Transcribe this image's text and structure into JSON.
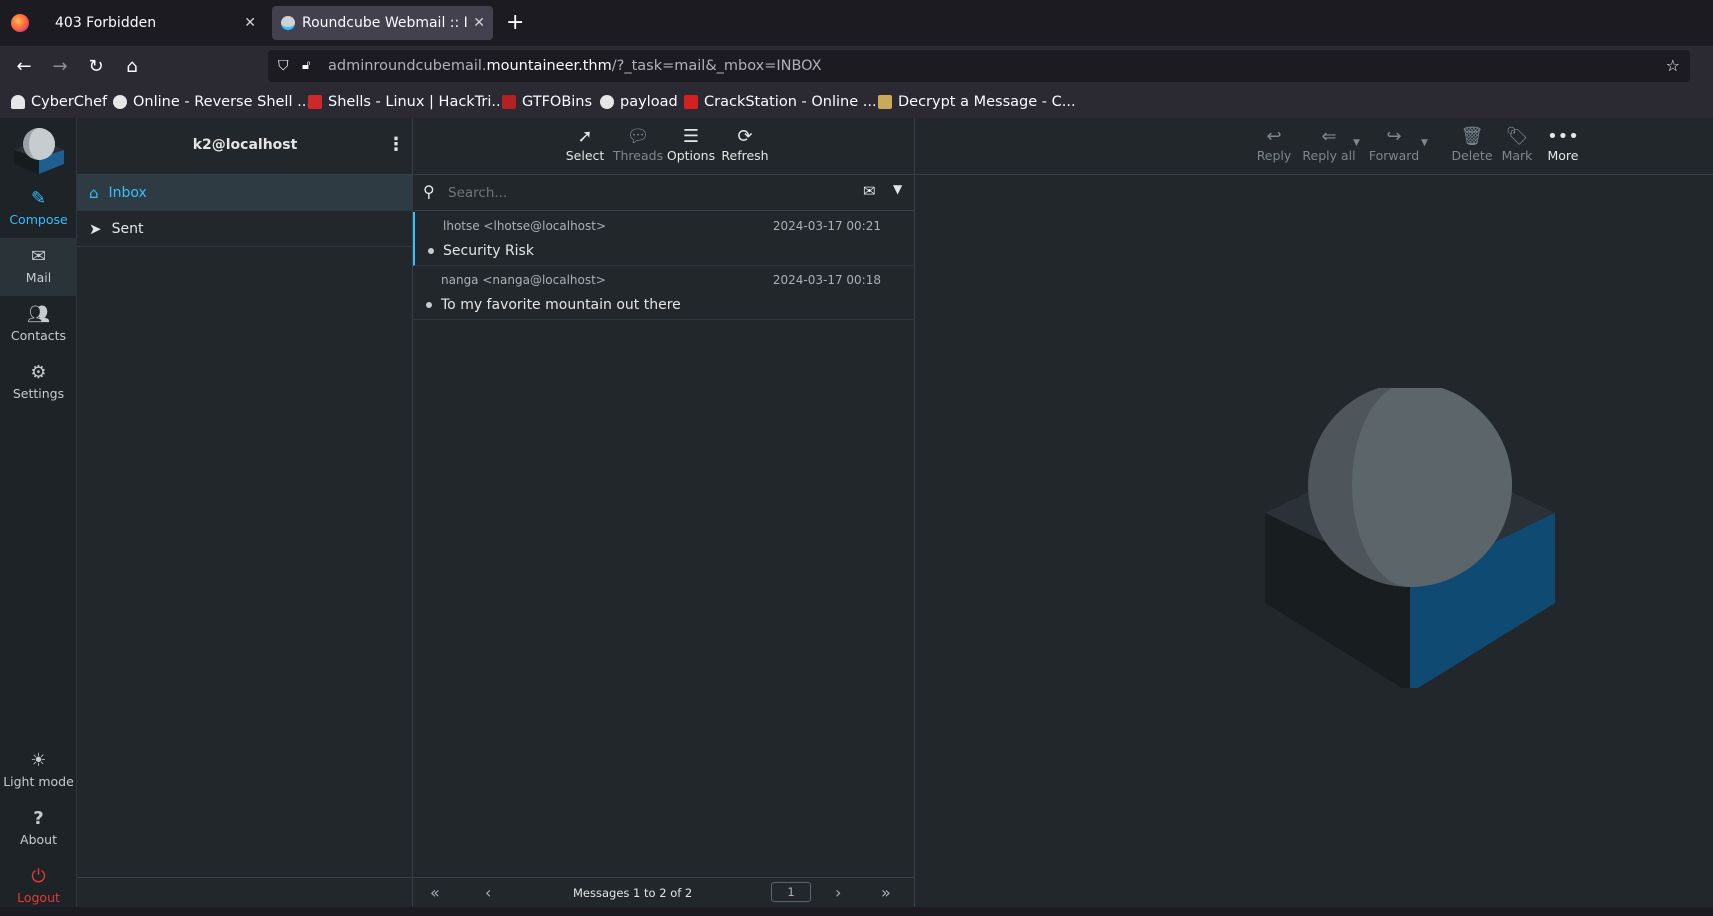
{
  "browser": {
    "tabs": [
      {
        "title": "403 Forbidden",
        "close": "✕"
      },
      {
        "title": "Roundcube Webmail :: Inbox",
        "close": "✕"
      }
    ],
    "new_tab": "+",
    "url": {
      "prefix": "adminroundcubemail.",
      "domain": "mountaineer.thm",
      "path": "/?_task=mail&_mbox=INBOX"
    },
    "bookmarks": [
      {
        "label": "CyberChef",
        "color": "#e6e6e6"
      },
      {
        "label": "Online - Reverse Shell ...",
        "color": "#e6e6e6"
      },
      {
        "label": "Shells - Linux | HackTri...",
        "color": "#cc2a2a"
      },
      {
        "label": "GTFOBins",
        "color": "#b32222"
      },
      {
        "label": "payload",
        "color": "#e6e6e6"
      },
      {
        "label": "CrackStation - Online ...",
        "color": "#d42020"
      },
      {
        "label": "Decrypt a Message - C...",
        "color": "#c9a95a"
      }
    ]
  },
  "app": {
    "nav": [
      {
        "label": "Compose",
        "icon": "compose-icon"
      },
      {
        "label": "Mail",
        "icon": "envelope-icon"
      },
      {
        "label": "Contacts",
        "icon": "contacts-icon"
      },
      {
        "label": "Settings",
        "icon": "gear-icon"
      }
    ],
    "nav_bottom": [
      {
        "label": "Light mode",
        "icon": "sun-icon"
      },
      {
        "label": "About",
        "icon": "question-icon"
      },
      {
        "label": "Logout",
        "icon": "power-icon"
      }
    ],
    "account": "k2@localhost",
    "folders": [
      {
        "label": "Inbox",
        "icon": "inbox-icon"
      },
      {
        "label": "Sent",
        "icon": "send-icon"
      }
    ],
    "list_toolbar": [
      {
        "label": "Select",
        "icon": "cursor-icon"
      },
      {
        "label": "Threads",
        "icon": "threads-icon"
      },
      {
        "label": "Options",
        "icon": "sliders-icon"
      },
      {
        "label": "Refresh",
        "icon": "refresh-icon"
      }
    ],
    "search_placeholder": "Search...",
    "messages": [
      {
        "from": "lhotse <lhotse@localhost>",
        "date": "2024-03-17 00:21",
        "subject": "Security Risk"
      },
      {
        "from": "nanga <nanga@localhost>",
        "date": "2024-03-17 00:18",
        "subject": "To my favorite mountain out there"
      }
    ],
    "pager": {
      "count": "Messages 1 to 2 of 2",
      "page": "1"
    },
    "preview_toolbar": [
      {
        "label": "Reply",
        "icon": "reply-icon"
      },
      {
        "label": "Reply all",
        "icon": "reply-all-icon"
      },
      {
        "label": "Forward",
        "icon": "forward-icon"
      },
      {
        "label": "Delete",
        "icon": "trash-icon"
      },
      {
        "label": "Mark",
        "icon": "tag-icon"
      },
      {
        "label": "More",
        "icon": "more-icon"
      }
    ],
    "colors": {
      "accent": "#37beff",
      "logout": "#e53935",
      "logo_blue": "#0f4a73",
      "selected": "#2f3b42"
    }
  }
}
